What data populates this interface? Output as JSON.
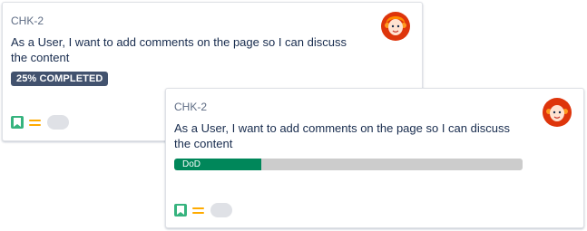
{
  "cards": [
    {
      "key": "CHK-2",
      "summary": "As a User, I want to add comments on the page so I can discuss the content",
      "status_lozenge": "25% COMPLETED",
      "avatar_icon": "user-avatar-icon",
      "issue_type_icon": "story-icon",
      "priority_icon": "priority-medium-icon"
    },
    {
      "key": "CHK-2",
      "summary": "As a User, I want to add comments on the page so I can discuss the content",
      "progress": {
        "label": "DoD",
        "fraction": 0.25,
        "fill_color": "#00875a",
        "track_color": "#cccccc"
      },
      "avatar_icon": "user-avatar-icon",
      "issue_type_icon": "story-icon",
      "priority_icon": "priority-medium-icon"
    }
  ],
  "colors": {
    "story": "#36b37e",
    "priority": "#ffab00",
    "lozenge_bg": "#42526e"
  }
}
